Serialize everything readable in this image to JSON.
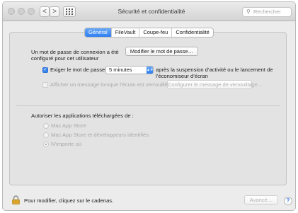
{
  "window": {
    "title": "Sécurité et confidentialité",
    "nav_back": "<",
    "nav_forward": ">",
    "grid_icon": "grid-icon"
  },
  "search": {
    "placeholder": "Rechercher"
  },
  "tabs": [
    {
      "label": "Général",
      "selected": true
    },
    {
      "label": "FileVault",
      "selected": false
    },
    {
      "label": "Coupe-feu",
      "selected": false
    },
    {
      "label": "Confidentialité",
      "selected": false
    }
  ],
  "general": {
    "password_text_line1": "Un mot de passe de connexion a été",
    "password_text_line2": "configuré pour cet utilisateur",
    "change_password_button": "Modifier le mot de passe…",
    "require_password_label": "Exiger le mot de passe",
    "require_password_checked": true,
    "delay_select_value": "5 minutes",
    "after_text_line1": "après la suspension d’activité ou le lancement de",
    "after_text_line2": "l’économiseur d’écran",
    "lock_message_label": "Afficher un message lorsque l’écran est verrouillé",
    "lock_message_checked": false,
    "lock_message_button": "Configurer le message de verrouillage…"
  },
  "downloads": {
    "heading": "Autoriser les applications téléchargées de :",
    "options": [
      {
        "label": "Mac App Store",
        "selected": false
      },
      {
        "label": "Mac App Store et développeurs identifiés",
        "selected": false
      },
      {
        "label": "N’importe où",
        "selected": true
      }
    ]
  },
  "footer": {
    "lock_text": "Pour modifier, cliquez sur le cadenas.",
    "advanced_button": "Avancé…",
    "help_button": "?"
  },
  "colors": {
    "accent": "#2d7ef0",
    "window_bg": "#ececec",
    "panel_bg": "#e3e3e3",
    "disabled_text": "#a9a9a9"
  }
}
